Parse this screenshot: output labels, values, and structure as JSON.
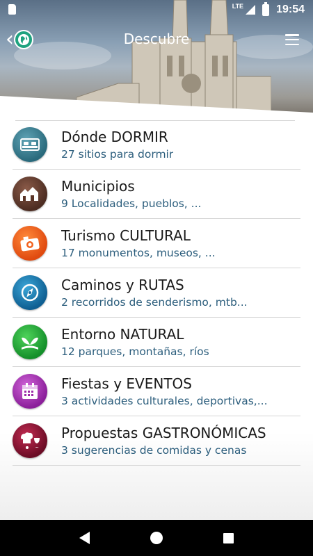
{
  "status_bar": {
    "network": "LTE",
    "time": "19:54"
  },
  "header": {
    "title": "Descubre"
  },
  "icons": {
    "back": "chevron-left-icon",
    "logo": "globe-icon",
    "menu": "hamburger-menu-icon"
  },
  "items": [
    {
      "title": "Dónde DORMIR",
      "subtitle": "27 sitios para dormir",
      "icon": "bed-icon",
      "color": "#2f7486"
    },
    {
      "title": "Municipios",
      "subtitle": "9 Localidades, pueblos, ...",
      "icon": "houses-icon",
      "color": "#5a3426"
    },
    {
      "title": "Turismo CULTURAL",
      "subtitle": "17 monumentos, museos, ...",
      "icon": "camera-icon",
      "color": "#f2621e"
    },
    {
      "title": "Caminos y RUTAS",
      "subtitle": "2 recorridos de senderismo, mtb...",
      "icon": "compass-icon",
      "color": "#17699c"
    },
    {
      "title": "Entorno NATURAL",
      "subtitle": "12 parques, montañas, ríos",
      "icon": "plant-icon",
      "color": "#1c9a32"
    },
    {
      "title": "Fiestas y EVENTOS",
      "subtitle": "3 actividades culturales, deportivas,...",
      "icon": "calendar-icon",
      "color": "#9c2aa8"
    },
    {
      "title": "Propuestas GASTRONÓMICAS",
      "subtitle": "3 sugerencias de comidas y cenas",
      "icon": "food-icon",
      "color": "#7a1330"
    }
  ]
}
